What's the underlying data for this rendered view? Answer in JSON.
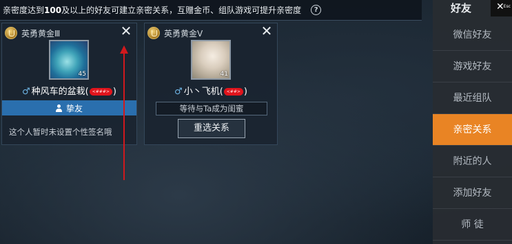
{
  "notice": {
    "text_before": "亲密度达到",
    "text_hi": "100",
    "text_after": "及以上的好友可建立亲密关系，互赠金币、组队游戏可提升亲密度",
    "help_glyph": "?"
  },
  "cards": [
    {
      "rank": "英勇黄金Ⅲ",
      "close_glyph": "✕",
      "level": "45",
      "gender_glyph": "♂",
      "name": "种风车的盆栽(",
      "name_close": ")",
      "redacted_text": "<###>",
      "relation_label": "挚友",
      "signature": "这个人暂时未设置个性签名哦"
    },
    {
      "rank": "英勇黄金Ⅴ",
      "close_glyph": "✕",
      "level": "41",
      "gender_glyph": "♂",
      "name": "小丶飞机(",
      "name_close": ")",
      "redacted_text": "<##>",
      "status": "等待与Ta成为闺蜜",
      "reselect_label": "重选关系"
    }
  ],
  "sidebar": {
    "title": "好友",
    "esc_glyph": "✕",
    "esc_label": "Esc",
    "items": [
      {
        "label": "微信好友"
      },
      {
        "label": "游戏好友"
      },
      {
        "label": "最近组队"
      },
      {
        "label": "亲密关系",
        "active": true
      },
      {
        "label": "附近的人"
      },
      {
        "label": "添加好友"
      },
      {
        "label": "师  徒"
      }
    ]
  },
  "colors": {
    "accent": "#e98424",
    "relation_bar": "#2a6fae",
    "arrow": "#d0191d"
  },
  "icons": [
    "help-icon",
    "rank-icon",
    "close-icon",
    "person-icon",
    "male-icon",
    "esc-icon"
  ]
}
